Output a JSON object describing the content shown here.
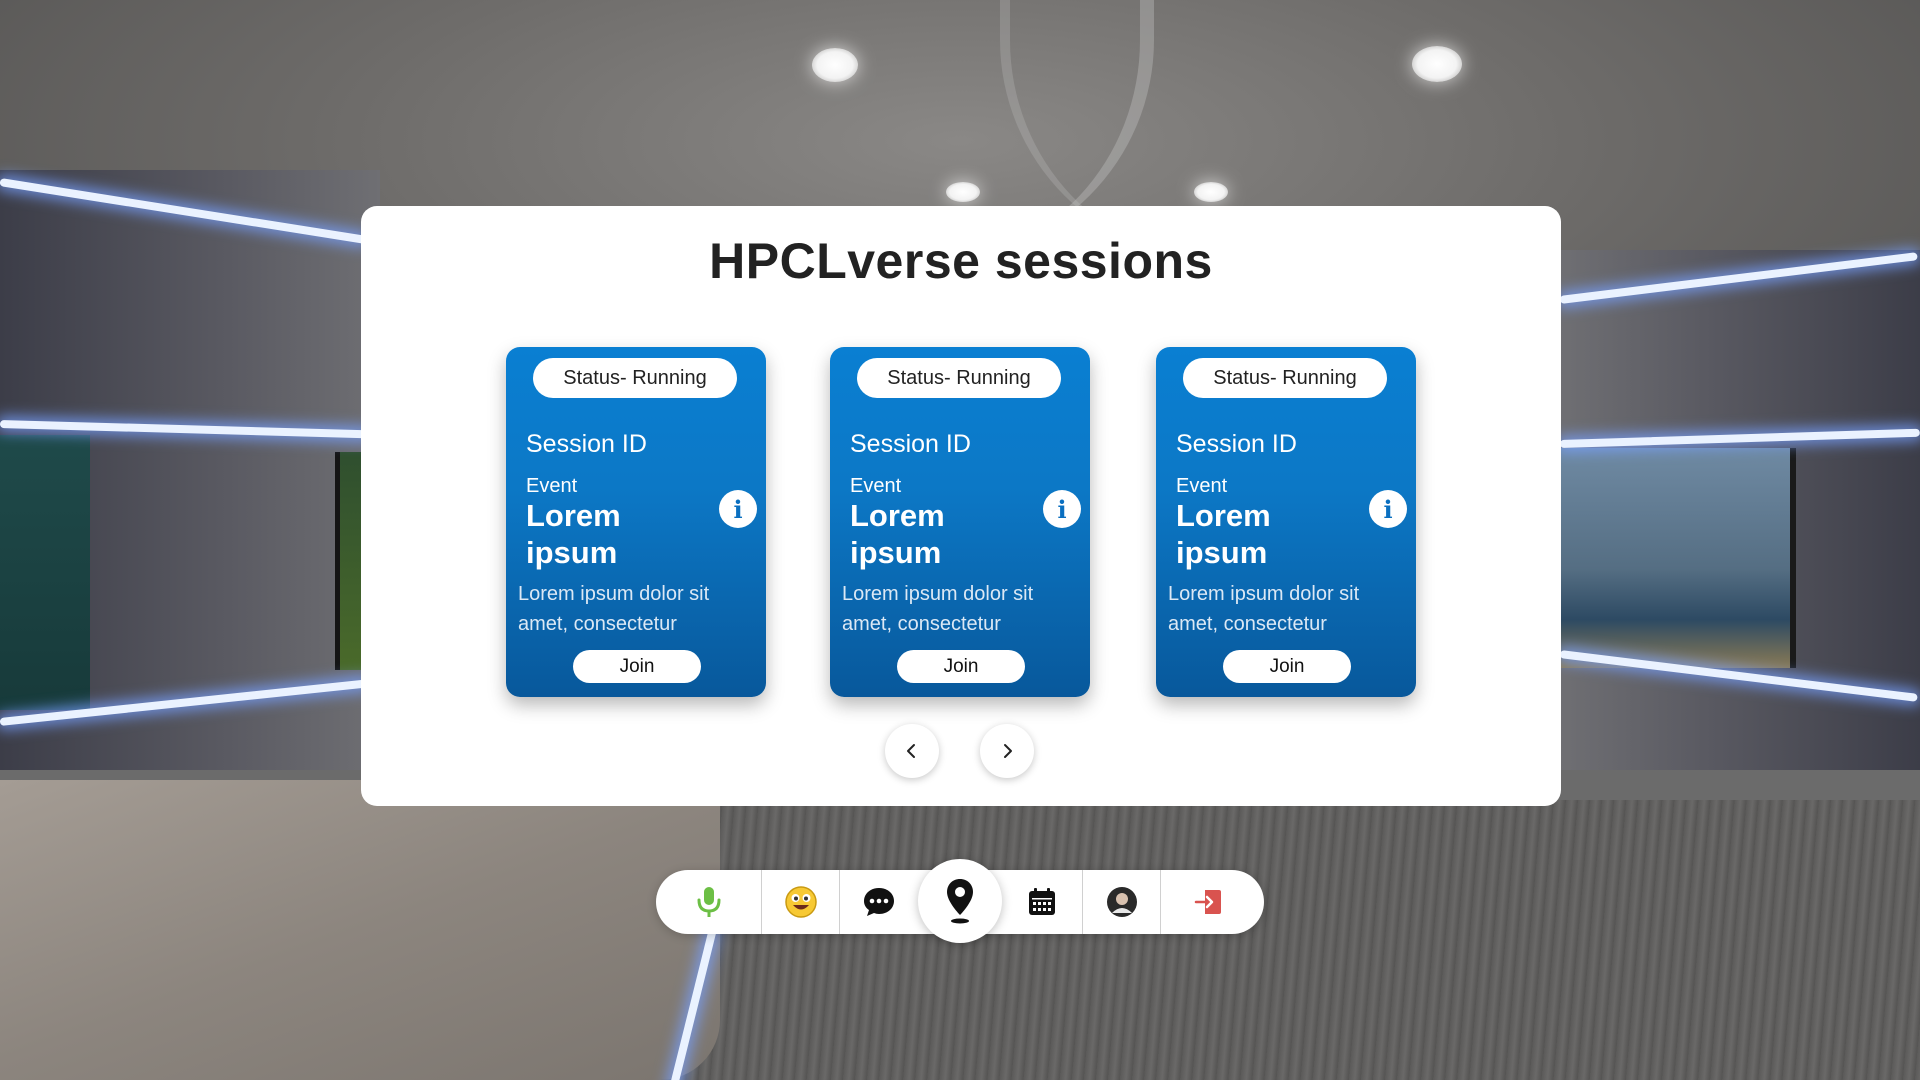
{
  "modal": {
    "title": "HPCLverse sessions"
  },
  "sessions": [
    {
      "status": "Status- Running",
      "session_id": "Session ID",
      "event_label": "Event",
      "event_name": "Lorem ipsum",
      "description": "Lorem ipsum dolor sit amet, consectetur",
      "join_label": "Join"
    },
    {
      "status": "Status- Running",
      "session_id": "Session ID",
      "event_label": "Event",
      "event_name": "Lorem ipsum",
      "description": "Lorem ipsum dolor sit amet, consectetur",
      "join_label": "Join"
    },
    {
      "status": "Status- Running",
      "session_id": "Session ID",
      "event_label": "Event",
      "event_name": "Lorem ipsum",
      "description": "Lorem ipsum dolor sit amet, consectetur",
      "join_label": "Join"
    }
  ],
  "info_glyph": "i",
  "pagination": {
    "prev_icon": "chevron-left-icon",
    "next_icon": "chevron-right-icon"
  },
  "toolbar": {
    "items": [
      "microphone-icon",
      "emoji-icon",
      "chat-icon",
      "location-pin-icon",
      "calendar-icon",
      "profile-avatar",
      "exit-icon"
    ],
    "active_item": "location-pin-icon"
  },
  "colors": {
    "card_top": "#0a7fd2",
    "card_bottom": "#08589b",
    "mic_green": "#6cbf45",
    "exit_red": "#d9534f"
  }
}
